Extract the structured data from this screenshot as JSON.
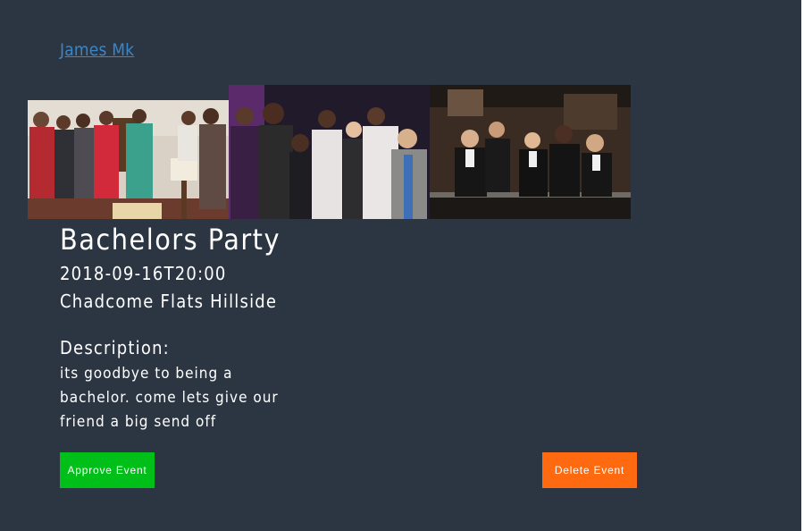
{
  "organizer": {
    "name": "James Mk"
  },
  "event": {
    "title": "Bachelors Party",
    "datetime": "2018-09-16T20:00",
    "location": "Chadcome Flats Hillside",
    "description_heading": "Description:",
    "description": "its goodbye to being a bachelor. come lets give our friend a big send off"
  },
  "photos": [
    {
      "subject": "group-toast-living-room"
    },
    {
      "subject": "group-party-night"
    },
    {
      "subject": "tuxedo-toast-bar"
    }
  ],
  "actions": {
    "approve_label": "Approve Event",
    "delete_label": "Delete Event"
  },
  "colors": {
    "background": "#2c3643",
    "link": "#3a86c6",
    "approve": "#00bf18",
    "delete": "#ff6a10",
    "text": "#ffffff"
  }
}
